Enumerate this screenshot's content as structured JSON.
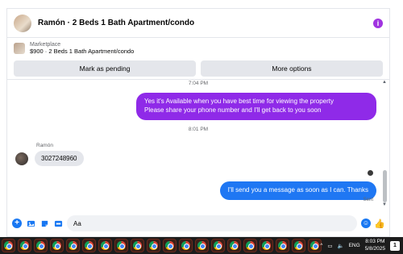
{
  "header": {
    "title": "Ramón · 2 Beds 1 Bath Apartment/condo",
    "info_icon": "info-icon"
  },
  "listing": {
    "source": "Marketplace",
    "price_title": "$900 · 2 Beds 1 Bath Apartment/condo"
  },
  "actions": {
    "mark_pending": "Mark as pending",
    "more_options": "More options"
  },
  "messages": {
    "time1": "7:04 PM",
    "out1_line1": "Yes it's Available when you have best time for viewing the property",
    "out1_line2": "Please share your phone number and I'll get back to you soon",
    "time2": "8:01 PM",
    "sender": "Ramón",
    "in1": "3027248960",
    "out2": "I'll send you a message as soon as I can. Thanks",
    "status": "Sent"
  },
  "composer": {
    "placeholder": "Aa"
  },
  "taskbar": {
    "app_count": 20,
    "language": "ENG",
    "time": "8:03 PM",
    "date": "5/8/2025",
    "notifications": "1"
  },
  "colors": {
    "outgoing_purple": "#8f2ae8",
    "outgoing_blue": "#1f77f3",
    "accent": "#1877f2"
  }
}
